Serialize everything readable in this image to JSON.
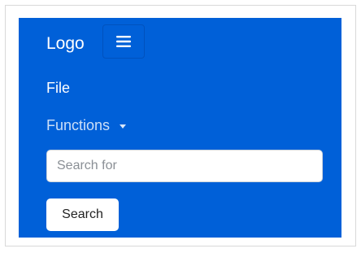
{
  "navbar": {
    "brand": "Logo",
    "toggler_icon": "hamburger-menu-icon",
    "background_color": "#0060d8",
    "items": [
      {
        "label": "File"
      },
      {
        "label": "Functions",
        "dropdown_icon": "caret-down-icon"
      }
    ],
    "search": {
      "placeholder": "Search for",
      "value": "",
      "button_label": "Search"
    }
  }
}
